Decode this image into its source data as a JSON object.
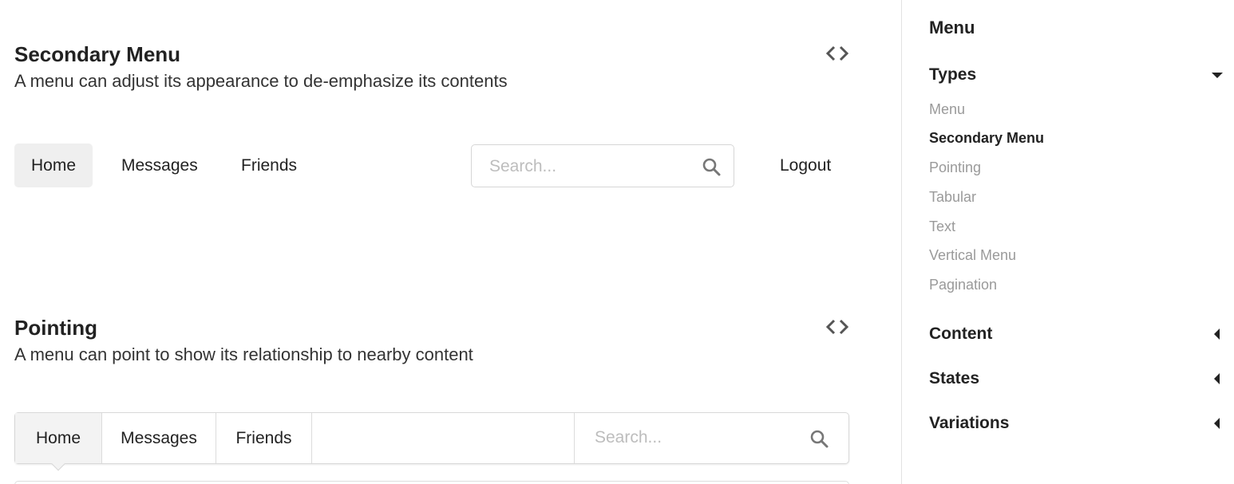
{
  "sections": {
    "secondary": {
      "title": "Secondary Menu",
      "description": "A menu can adjust its appearance to de-emphasize its contents",
      "menu": {
        "items": [
          "Home",
          "Messages",
          "Friends"
        ],
        "active": "Home",
        "search_placeholder": "Search...",
        "logout_label": "Logout"
      }
    },
    "pointing": {
      "title": "Pointing",
      "description": "A menu can point to show its relationship to nearby content",
      "menu": {
        "items": [
          "Home",
          "Messages",
          "Friends"
        ],
        "active": "Home",
        "search_placeholder": "Search..."
      }
    }
  },
  "sidebar": {
    "title": "Menu",
    "groups": [
      {
        "label": "Types",
        "expanded": true,
        "items": [
          "Menu",
          "Secondary Menu",
          "Pointing",
          "Tabular",
          "Text",
          "Vertical Menu",
          "Pagination"
        ],
        "active_item": "Secondary Menu"
      },
      {
        "label": "Content",
        "expanded": false
      },
      {
        "label": "States",
        "expanded": false
      },
      {
        "label": "Variations",
        "expanded": false
      }
    ]
  },
  "icons": [
    "code-icon",
    "search-icon",
    "caret-down-icon",
    "caret-left-icon"
  ],
  "colors": {
    "active_item_bg": "#efefef",
    "border": "#d6d6d6",
    "muted_text": "#9a9a9a",
    "placeholder": "#bdbdbd"
  }
}
